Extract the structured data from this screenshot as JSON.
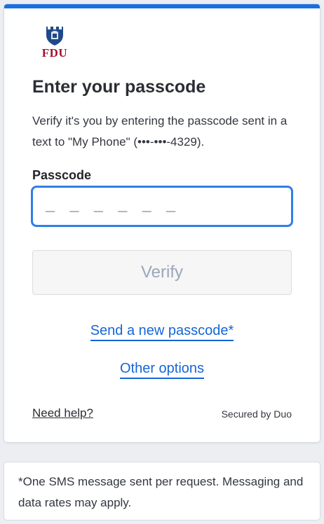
{
  "brand": {
    "logo_text": "FDU",
    "accent_color": "#1a6fe0",
    "brand_color": "#a3122f"
  },
  "main": {
    "title": "Enter your passcode",
    "description": "Verify it's you by entering the passcode sent in a text to \"My Phone\" (•••-•••-4329).",
    "passcode_label": "Passcode",
    "passcode_placeholder": "_ _ _ _ _ _",
    "passcode_value": "",
    "verify_label": "Verify",
    "send_new_label": "Send a new passcode*",
    "other_options_label": "Other options"
  },
  "footer": {
    "need_help_label": "Need help?",
    "secured_by": "Secured by Duo"
  },
  "footnote": {
    "text": "*One SMS message sent per request. Messaging and data rates may apply."
  }
}
